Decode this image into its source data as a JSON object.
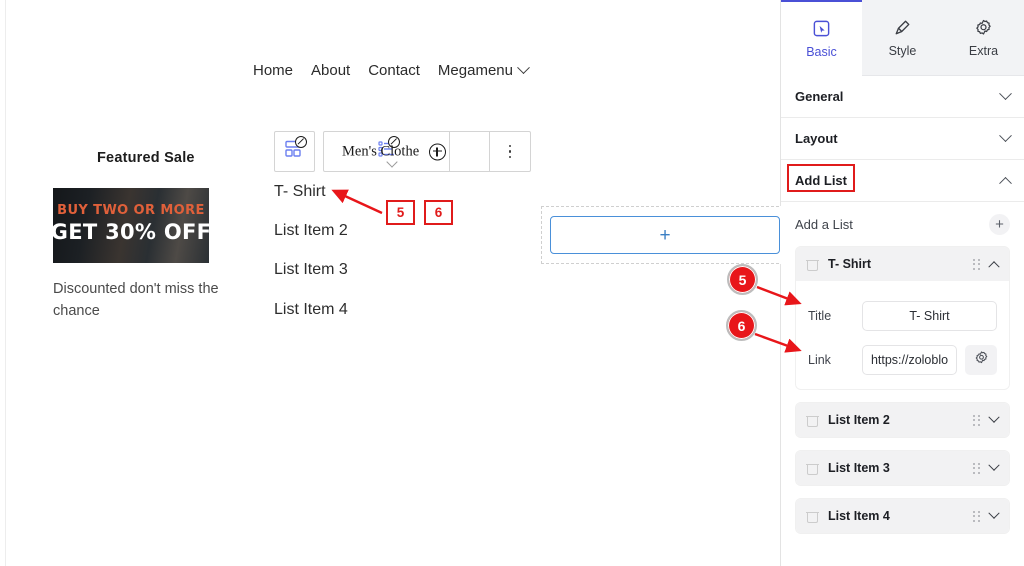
{
  "canvas": {
    "nav": {
      "items": [
        {
          "label": "Home",
          "icon": null
        },
        {
          "label": "About",
          "icon": null
        },
        {
          "label": "Contact",
          "icon": null
        },
        {
          "label": "Megamenu",
          "icon": "chevron-down-icon"
        }
      ]
    },
    "featured": {
      "title": "Featured Sale",
      "promo_line1": "BUY TWO OR MORE",
      "promo_line2": "GET 30% OFF",
      "description": "Discounted don't miss the chance"
    },
    "widget_toolbar": {
      "column_icon": "column-layout-icon",
      "widget_icon": "list-widget-icon",
      "widget_label": "Men's Clothe",
      "add_icon": "plus-circle-icon",
      "dropdown_icon": "chevron-down-icon",
      "more_icon": "more-vertical-icon"
    },
    "list_items": [
      "T- Shirt",
      "List Item 2",
      "List Item 3",
      "List Item 4"
    ],
    "add_section": {
      "plus_label": "+"
    }
  },
  "annotations": {
    "marker_5": "5",
    "marker_6": "6",
    "rect_5": "5",
    "rect_6": "6"
  },
  "panel": {
    "tabs": [
      {
        "label": "Basic",
        "icon": "cursor-box-icon",
        "active": true
      },
      {
        "label": "Style",
        "icon": "paintbrush-icon",
        "active": false
      },
      {
        "label": "Extra",
        "icon": "gear-icon",
        "active": false
      }
    ],
    "sections": [
      {
        "label": "General",
        "state": "collapsed"
      },
      {
        "label": "Layout",
        "state": "collapsed"
      },
      {
        "label": "Add List",
        "state": "expanded"
      }
    ],
    "add_a_list": {
      "label": "Add a List",
      "add_icon": "plus-icon"
    },
    "items": [
      {
        "name": "T- Shirt",
        "expanded": true,
        "fields": {
          "title_label": "Title",
          "title_value": "T- Shirt",
          "link_label": "Link",
          "link_value": "https://zoloblo",
          "link_settings_icon": "gear-icon"
        }
      },
      {
        "name": "List Item 2",
        "expanded": false
      },
      {
        "name": "List Item 3",
        "expanded": false
      },
      {
        "name": "List Item 4",
        "expanded": false
      }
    ],
    "accent_color": "#4a50d6"
  }
}
